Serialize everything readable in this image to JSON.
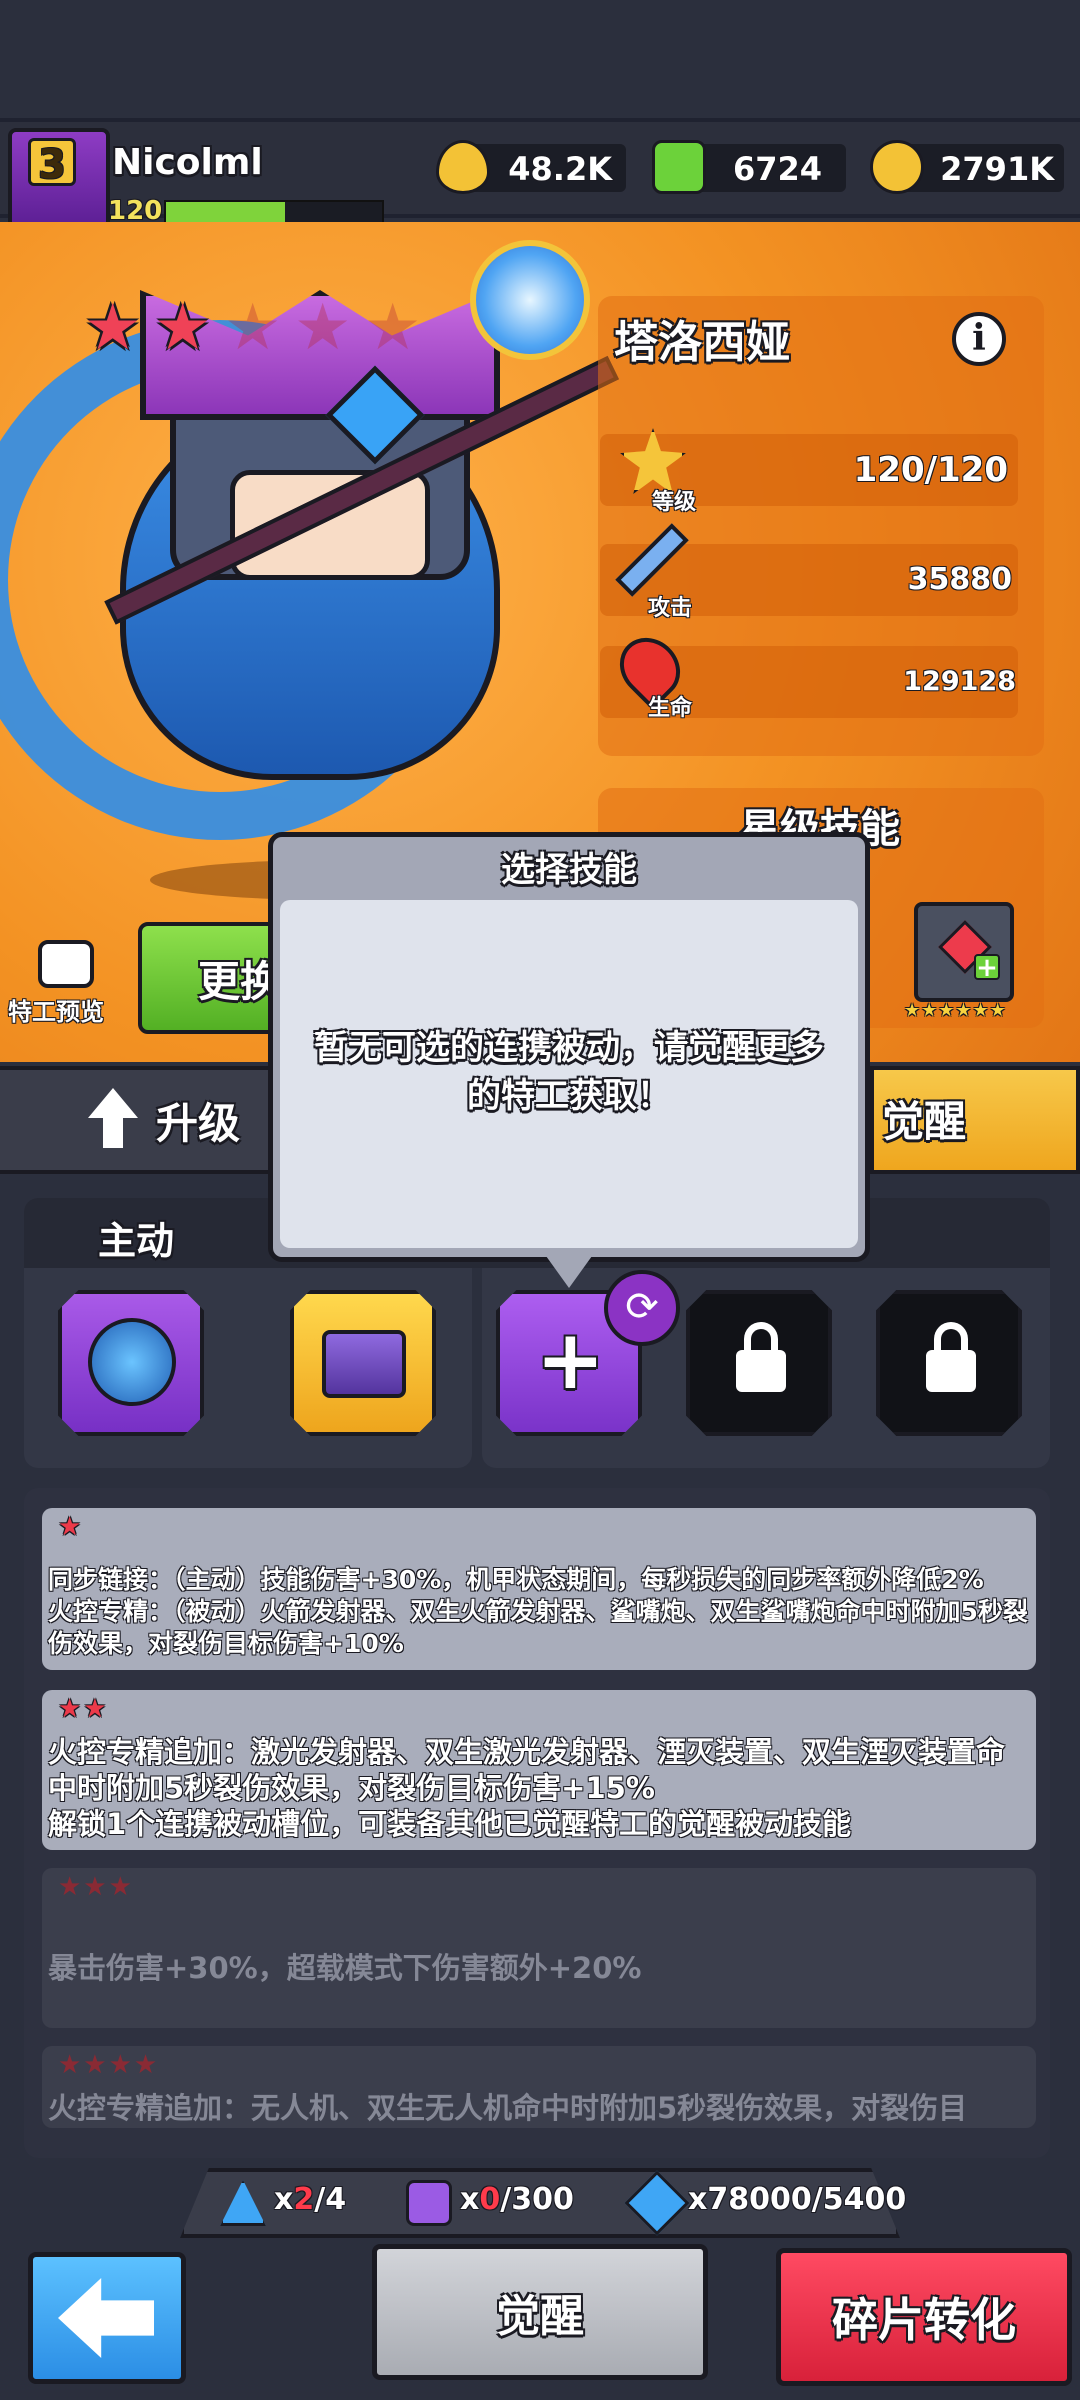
{
  "player": {
    "name": "Nicolml",
    "rank": "3",
    "level": "120",
    "xp_fraction": 0.55
  },
  "resources": [
    {
      "icon": "oil-drop-icon",
      "value": "48.2K",
      "color": "#f3c236"
    },
    {
      "icon": "green-gem-plus-icon",
      "value": "6724",
      "color": "#6cd23a"
    },
    {
      "icon": "gold-coin-plus-icon",
      "value": "2791K",
      "color": "#f3c236"
    }
  ],
  "hero": {
    "name": "塔洛西娅",
    "stars_filled": 2,
    "stars_total": 5,
    "stats": [
      {
        "label": "等级",
        "value": "120/120",
        "icon": "level-star-icon"
      },
      {
        "label": "攻击",
        "value": "35880",
        "icon": "sword-icon"
      },
      {
        "label": "生命",
        "value": "129128",
        "icon": "heart-icon"
      }
    ]
  },
  "star_skill": {
    "title": "星级技能",
    "stars": "★★★★★★"
  },
  "actions": {
    "preview": "特工预览",
    "change": "更换"
  },
  "tabs": {
    "upgrade": "升级",
    "awaken": "觉醒"
  },
  "skills": {
    "active_label": "主动"
  },
  "tooltip": {
    "title": "选择技能",
    "message": "暂无可选的连携被动，请觉醒更多的特工获取！"
  },
  "descriptions": [
    {
      "stars": "★",
      "active": true,
      "text": "同步链接：（主动）技能伤害+30%，机甲状态期间，每秒损失的同步率额外降低2%\n火控专精：（被动）火箭发射器、双生火箭发射器、鲨嘴炮、双生鲨嘴炮命中时附加5秒裂伤效果，对裂伤目标伤害+10%"
    },
    {
      "stars": "★★",
      "active": true,
      "text": "火控专精追加：激光发射器、双生激光发射器、湮灭装置、双生湮灭装置命中时附加5秒裂伤效果，对裂伤目标伤害+15%\n解锁1个连携被动槽位，可装备其他已觉醒特工的觉醒被动技能"
    },
    {
      "stars": "★★★",
      "active": false,
      "text": "暴击伤害+30%，超载模式下伤害额外+20%"
    },
    {
      "stars": "★★★★",
      "active": false,
      "text": "火控专精追加：无人机、双生无人机命中时附加5秒裂伤效果，对裂伤目"
    }
  ],
  "materials": [
    {
      "icon": "awaken-crystal-icon",
      "prefix": "x",
      "have": "2",
      "need": "/4",
      "have_color": "#ff3b4b"
    },
    {
      "icon": "purple-shard-icon",
      "prefix": "x",
      "have": "0",
      "need": "/300",
      "have_color": "#ff3b4b"
    },
    {
      "icon": "blue-shard-icon",
      "prefix": "x",
      "have": "78000",
      "need": "/5400",
      "have_color": "#ffffff"
    }
  ],
  "bottom": {
    "awaken": "觉醒",
    "convert": "碎片转化"
  },
  "colors": {
    "accent_orange": "#f39223",
    "accent_gold": "#f7c84a",
    "accent_red": "#e8283f",
    "accent_blue": "#3fa6f5"
  }
}
